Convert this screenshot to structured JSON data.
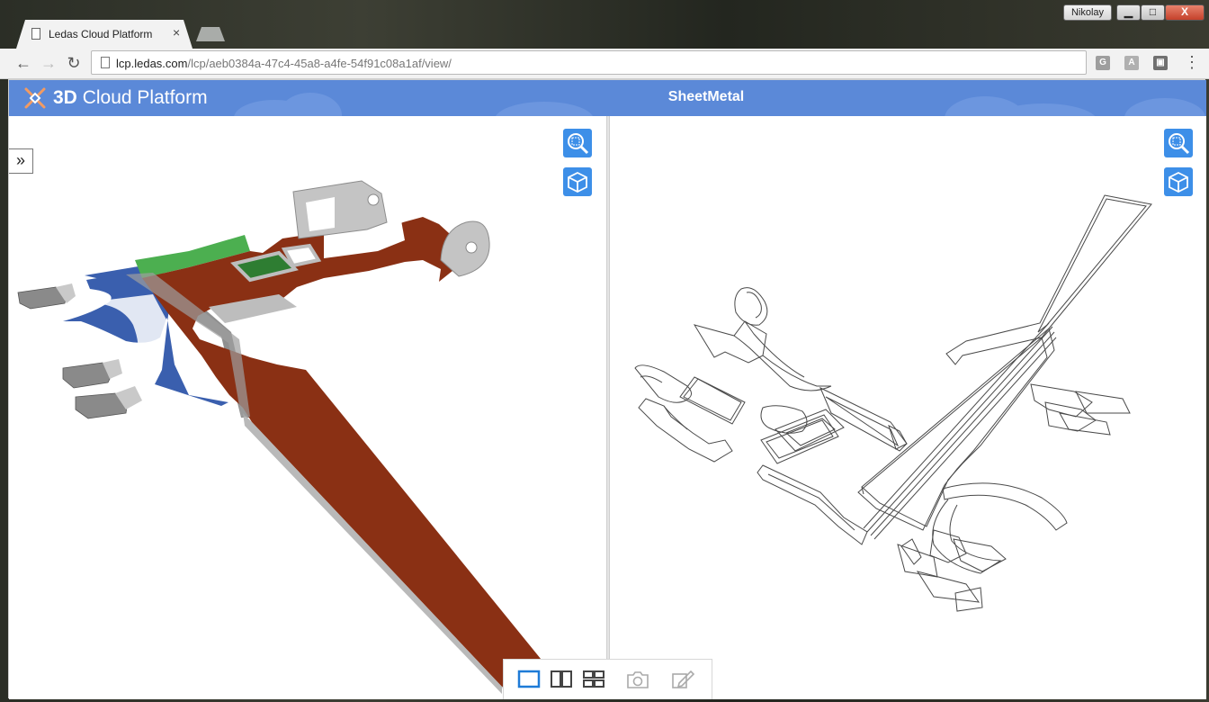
{
  "browser": {
    "user_name": "Nikolay",
    "window_controls": {
      "minimize": "▁",
      "maximize": "□",
      "close": "X"
    },
    "tab": {
      "title": "Ledas Cloud Platform",
      "close": "×"
    },
    "url_host": "lcp.ledas.com",
    "url_path": "/lcp/aeb0384a-47c4-45a8-a4fe-54f91c08a1af/view/",
    "nav": {
      "back": "←",
      "forward": "→",
      "reload": "↻"
    },
    "extensions": [
      "G",
      "A",
      "▣"
    ],
    "menu": "⋮"
  },
  "app": {
    "brand_bold": "3D",
    "brand_rest": " Cloud Platform",
    "document_title": "SheetMetal",
    "sidebar_toggle": "»",
    "colors": {
      "header": "#5b89d8",
      "accent_button": "#3d8fe8",
      "part_body": "#8a3014",
      "face_blue": "#3a5fae",
      "face_green": "#4caf50",
      "face_dark_green": "#2e7d32",
      "edge_gray": "#b9b9b9"
    },
    "viewports": [
      {
        "name": "shaded",
        "tools": [
          "zoom-fit-icon",
          "view-cube-icon"
        ]
      },
      {
        "name": "wireframe",
        "tools": [
          "zoom-fit-icon",
          "view-cube-icon"
        ]
      }
    ],
    "bottom_toolbar": [
      "single-view-icon",
      "two-views-icon",
      "four-views-icon",
      "camera-icon",
      "edit-icon"
    ]
  }
}
